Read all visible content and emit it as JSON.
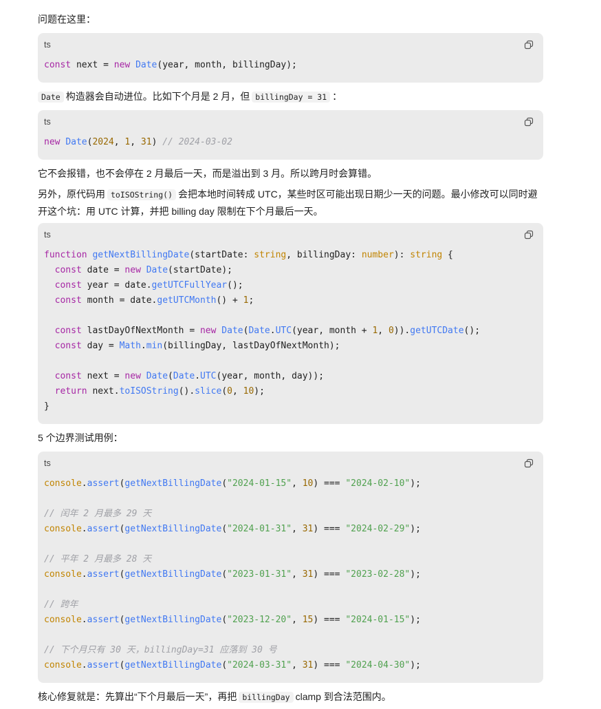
{
  "paragraphs": {
    "p1": "问题在这里：",
    "p2_code1": "Date",
    "p2_text1": "构造器会自动进位。比如下个月是 2 月，但",
    "p2_code2": "billingDay = 31",
    "p2_text2": "：",
    "p3": "它不会报错，也不会停在 2 月最后一天，而是溢出到 3 月。所以跨月时会算错。",
    "p4_text1": "另外，原代码用",
    "p4_code": "toISOString()",
    "p4_text2": "会把本地时间转成 UTC，某些时区可能出现日期少一天的问题。最小修改可以同时避开这个坑：用 UTC 计算，并把 billing day 限制在下个月最后一天。",
    "p5": "5 个边界测试用例：",
    "p6_text1": "核心修复就是：先算出“下个月最后一天”，再把",
    "p6_code": "billingDay",
    "p6_text2": "clamp 到合法范围内。"
  },
  "code_blocks": [
    {
      "lang": "ts",
      "lines": [
        [
          [
            "kw",
            "const"
          ],
          [
            "p",
            " next = "
          ],
          [
            "kw",
            "new"
          ],
          [
            "p",
            " "
          ],
          [
            "fn",
            "Date"
          ],
          [
            "p",
            "(year, month, billingDay);"
          ]
        ]
      ]
    },
    {
      "lang": "ts",
      "lines": [
        [
          [
            "kw",
            "new"
          ],
          [
            "p",
            " "
          ],
          [
            "fn",
            "Date"
          ],
          [
            "p",
            "("
          ],
          [
            "num",
            "2024"
          ],
          [
            "p",
            ", "
          ],
          [
            "num",
            "1"
          ],
          [
            "p",
            ", "
          ],
          [
            "num",
            "31"
          ],
          [
            "p",
            ") "
          ],
          [
            "com",
            "// 2024-03-02"
          ]
        ]
      ]
    },
    {
      "lang": "ts",
      "lines": [
        [
          [
            "kw",
            "function"
          ],
          [
            "p",
            " "
          ],
          [
            "fn",
            "getNextBillingDate"
          ],
          [
            "p",
            "(startDate: "
          ],
          [
            "ty",
            "string"
          ],
          [
            "p",
            ", billingDay: "
          ],
          [
            "ty",
            "number"
          ],
          [
            "p",
            "): "
          ],
          [
            "ty",
            "string"
          ],
          [
            "p",
            " {"
          ]
        ],
        [
          [
            "p",
            "  "
          ],
          [
            "kw",
            "const"
          ],
          [
            "p",
            " date = "
          ],
          [
            "kw",
            "new"
          ],
          [
            "p",
            " "
          ],
          [
            "fn",
            "Date"
          ],
          [
            "p",
            "(startDate);"
          ]
        ],
        [
          [
            "p",
            "  "
          ],
          [
            "kw",
            "const"
          ],
          [
            "p",
            " year = date."
          ],
          [
            "fn",
            "getUTCFullYear"
          ],
          [
            "p",
            "();"
          ]
        ],
        [
          [
            "p",
            "  "
          ],
          [
            "kw",
            "const"
          ],
          [
            "p",
            " month = date."
          ],
          [
            "fn",
            "getUTCMonth"
          ],
          [
            "p",
            "() + "
          ],
          [
            "num",
            "1"
          ],
          [
            "p",
            ";"
          ]
        ],
        [],
        [
          [
            "p",
            "  "
          ],
          [
            "kw",
            "const"
          ],
          [
            "p",
            " lastDayOfNextMonth = "
          ],
          [
            "kw",
            "new"
          ],
          [
            "p",
            " "
          ],
          [
            "fn",
            "Date"
          ],
          [
            "p",
            "("
          ],
          [
            "fn",
            "Date"
          ],
          [
            "p",
            "."
          ],
          [
            "fn",
            "UTC"
          ],
          [
            "p",
            "(year, month + "
          ],
          [
            "num",
            "1"
          ],
          [
            "p",
            ", "
          ],
          [
            "num",
            "0"
          ],
          [
            "p",
            "))."
          ],
          [
            "fn",
            "getUTCDate"
          ],
          [
            "p",
            "();"
          ]
        ],
        [
          [
            "p",
            "  "
          ],
          [
            "kw",
            "const"
          ],
          [
            "p",
            " day = "
          ],
          [
            "fn",
            "Math"
          ],
          [
            "p",
            "."
          ],
          [
            "fn",
            "min"
          ],
          [
            "p",
            "(billingDay, lastDayOfNextMonth);"
          ]
        ],
        [],
        [
          [
            "p",
            "  "
          ],
          [
            "kw",
            "const"
          ],
          [
            "p",
            " next = "
          ],
          [
            "kw",
            "new"
          ],
          [
            "p",
            " "
          ],
          [
            "fn",
            "Date"
          ],
          [
            "p",
            "("
          ],
          [
            "fn",
            "Date"
          ],
          [
            "p",
            "."
          ],
          [
            "fn",
            "UTC"
          ],
          [
            "p",
            "(year, month, day));"
          ]
        ],
        [
          [
            "p",
            "  "
          ],
          [
            "kw",
            "return"
          ],
          [
            "p",
            " next."
          ],
          [
            "fn",
            "toISOString"
          ],
          [
            "p",
            "()."
          ],
          [
            "fn",
            "slice"
          ],
          [
            "p",
            "("
          ],
          [
            "num",
            "0"
          ],
          [
            "p",
            ", "
          ],
          [
            "num",
            "10"
          ],
          [
            "p",
            ");"
          ]
        ],
        [
          [
            "p",
            "}"
          ]
        ]
      ]
    },
    {
      "lang": "ts",
      "lines": [
        [
          [
            "ty",
            "console"
          ],
          [
            "p",
            "."
          ],
          [
            "fn",
            "assert"
          ],
          [
            "p",
            "("
          ],
          [
            "fn",
            "getNextBillingDate"
          ],
          [
            "p",
            "("
          ],
          [
            "str",
            "\"2024-01-15\""
          ],
          [
            "p",
            ", "
          ],
          [
            "num",
            "10"
          ],
          [
            "p",
            ") === "
          ],
          [
            "str",
            "\"2024-02-10\""
          ],
          [
            "p",
            ");"
          ]
        ],
        [],
        [
          [
            "com",
            "// 闰年 2 月最多 29 天"
          ]
        ],
        [
          [
            "ty",
            "console"
          ],
          [
            "p",
            "."
          ],
          [
            "fn",
            "assert"
          ],
          [
            "p",
            "("
          ],
          [
            "fn",
            "getNextBillingDate"
          ],
          [
            "p",
            "("
          ],
          [
            "str",
            "\"2024-01-31\""
          ],
          [
            "p",
            ", "
          ],
          [
            "num",
            "31"
          ],
          [
            "p",
            ") === "
          ],
          [
            "str",
            "\"2024-02-29\""
          ],
          [
            "p",
            ");"
          ]
        ],
        [],
        [
          [
            "com",
            "// 平年 2 月最多 28 天"
          ]
        ],
        [
          [
            "ty",
            "console"
          ],
          [
            "p",
            "."
          ],
          [
            "fn",
            "assert"
          ],
          [
            "p",
            "("
          ],
          [
            "fn",
            "getNextBillingDate"
          ],
          [
            "p",
            "("
          ],
          [
            "str",
            "\"2023-01-31\""
          ],
          [
            "p",
            ", "
          ],
          [
            "num",
            "31"
          ],
          [
            "p",
            ") === "
          ],
          [
            "str",
            "\"2023-02-28\""
          ],
          [
            "p",
            ");"
          ]
        ],
        [],
        [
          [
            "com",
            "// 跨年"
          ]
        ],
        [
          [
            "ty",
            "console"
          ],
          [
            "p",
            "."
          ],
          [
            "fn",
            "assert"
          ],
          [
            "p",
            "("
          ],
          [
            "fn",
            "getNextBillingDate"
          ],
          [
            "p",
            "("
          ],
          [
            "str",
            "\"2023-12-20\""
          ],
          [
            "p",
            ", "
          ],
          [
            "num",
            "15"
          ],
          [
            "p",
            ") === "
          ],
          [
            "str",
            "\"2024-01-15\""
          ],
          [
            "p",
            ");"
          ]
        ],
        [],
        [
          [
            "com",
            "// 下个月只有 30 天，billingDay=31 应落到 30 号"
          ]
        ],
        [
          [
            "ty",
            "console"
          ],
          [
            "p",
            "."
          ],
          [
            "fn",
            "assert"
          ],
          [
            "p",
            "("
          ],
          [
            "fn",
            "getNextBillingDate"
          ],
          [
            "p",
            "("
          ],
          [
            "str",
            "\"2024-03-31\""
          ],
          [
            "p",
            ", "
          ],
          [
            "num",
            "31"
          ],
          [
            "p",
            ") === "
          ],
          [
            "str",
            "\"2024-04-30\""
          ],
          [
            "p",
            ");"
          ]
        ]
      ]
    }
  ]
}
